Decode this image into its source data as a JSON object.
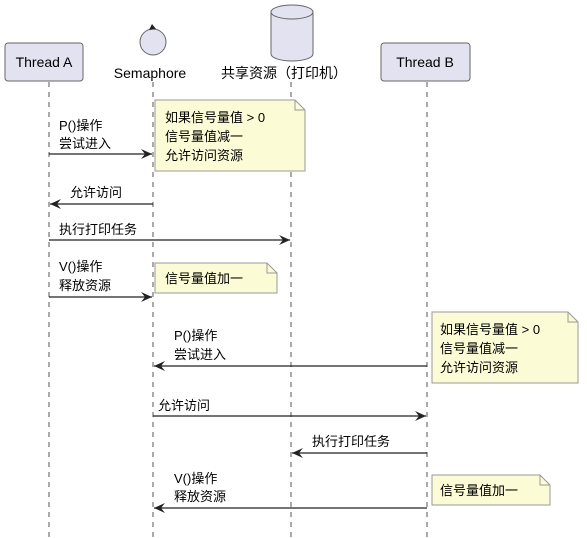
{
  "participants": {
    "thread_a": "Thread A",
    "semaphore": "Semaphore",
    "resource": "共享资源（打印机）",
    "thread_b": "Thread B"
  },
  "messages": [
    {
      "lines": [
        "P()操作",
        "尝试进入"
      ]
    },
    {
      "lines": [
        "允许访问"
      ]
    },
    {
      "lines": [
        "执行打印任务"
      ]
    },
    {
      "lines": [
        "V()操作",
        "释放资源"
      ]
    },
    {
      "lines": [
        "P()操作",
        "尝试进入"
      ]
    },
    {
      "lines": [
        "允许访问"
      ]
    },
    {
      "lines": [
        "执行打印任务"
      ]
    },
    {
      "lines": [
        "V()操作",
        "释放资源"
      ]
    }
  ],
  "notes": [
    {
      "lines": [
        "如果信号量值 > 0",
        "信号量值减一",
        "允许访问资源"
      ]
    },
    {
      "lines": [
        "信号量值加一"
      ]
    },
    {
      "lines": [
        "如果信号量值 > 0",
        "信号量值减一",
        "允许访问资源"
      ]
    },
    {
      "lines": [
        "信号量值加一"
      ]
    }
  ],
  "colors": {
    "participant_fill": "#e2e2f0",
    "note_fill": "#fbfbd6"
  }
}
